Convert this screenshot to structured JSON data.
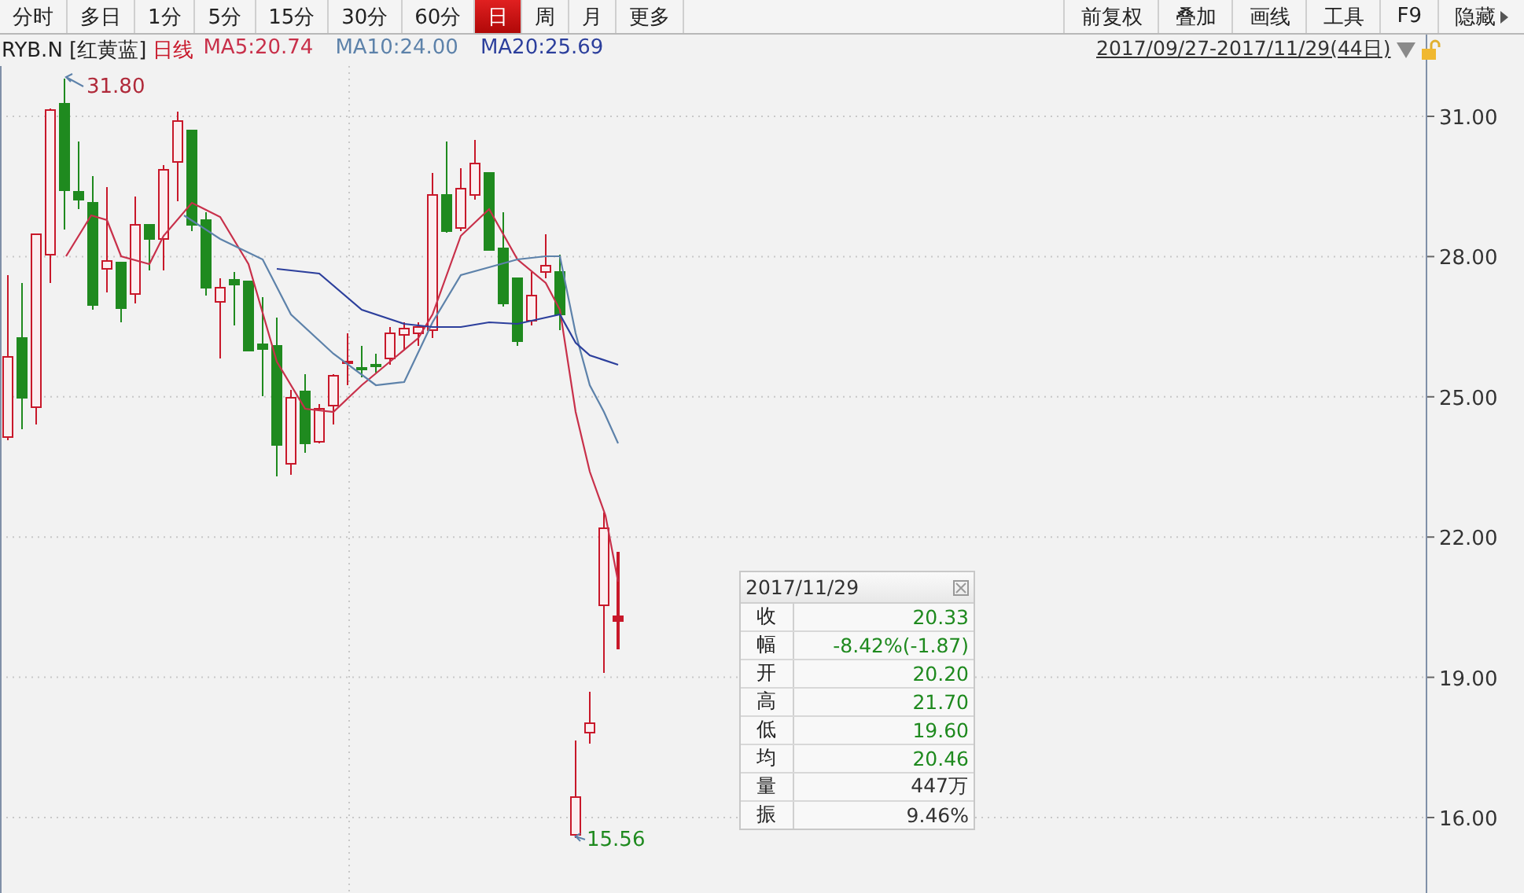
{
  "toolbar": {
    "period_tabs": [
      {
        "label": "分时",
        "selected": false
      },
      {
        "label": "多日",
        "selected": false
      },
      {
        "label": "1分",
        "selected": false
      },
      {
        "label": "5分",
        "selected": false
      },
      {
        "label": "15分",
        "selected": false
      },
      {
        "label": "30分",
        "selected": false
      },
      {
        "label": "60分",
        "selected": false
      },
      {
        "label": "日",
        "selected": true
      },
      {
        "label": "周",
        "selected": false
      },
      {
        "label": "月",
        "selected": false
      },
      {
        "label": "更多",
        "selected": false
      }
    ],
    "tools": [
      {
        "label": "前复权",
        "kind": "plain"
      },
      {
        "label": "叠加",
        "kind": "plain"
      },
      {
        "label": "画线",
        "kind": "plain"
      },
      {
        "label": "工具",
        "kind": "plain"
      },
      {
        "label": "F9",
        "kind": "plain"
      },
      {
        "label": "隐藏",
        "kind": "expand"
      }
    ]
  },
  "legend": {
    "symbol": "RYB.N [红黄蓝]",
    "period": "日线",
    "moving_averages": [
      {
        "label": "MA5:20.74",
        "color": "#c8304a"
      },
      {
        "label": "MA10:24.00",
        "color": "#5d82aa"
      },
      {
        "label": "MA20:25.69",
        "color": "#2c3f9c"
      }
    ]
  },
  "date_range": "2017/09/27-2017/11/29(44日)",
  "chart": {
    "y_axis_labels": [
      "31.00",
      "28.00",
      "25.00",
      "22.00",
      "19.00",
      "16.00"
    ],
    "high_label": "31.80",
    "low_label": "15.56"
  },
  "tooltip": {
    "title": "2017/11/29",
    "rows": [
      {
        "label": "收",
        "value": "20.33",
        "color": "#1f8a1f"
      },
      {
        "label": "幅",
        "value": "-8.42%(-1.87)",
        "color": "#1f8a1f"
      },
      {
        "label": "开",
        "value": "20.20",
        "color": "#1f8a1f"
      },
      {
        "label": "高",
        "value": "21.70",
        "color": "#1f8a1f"
      },
      {
        "label": "低",
        "value": "19.60",
        "color": "#1f8a1f"
      },
      {
        "label": "均",
        "value": "20.46",
        "color": "#1f8a1f"
      },
      {
        "label": "量",
        "value": "447万",
        "color": "#333333"
      },
      {
        "label": "振",
        "value": "9.46%",
        "color": "#333333"
      }
    ]
  }
}
